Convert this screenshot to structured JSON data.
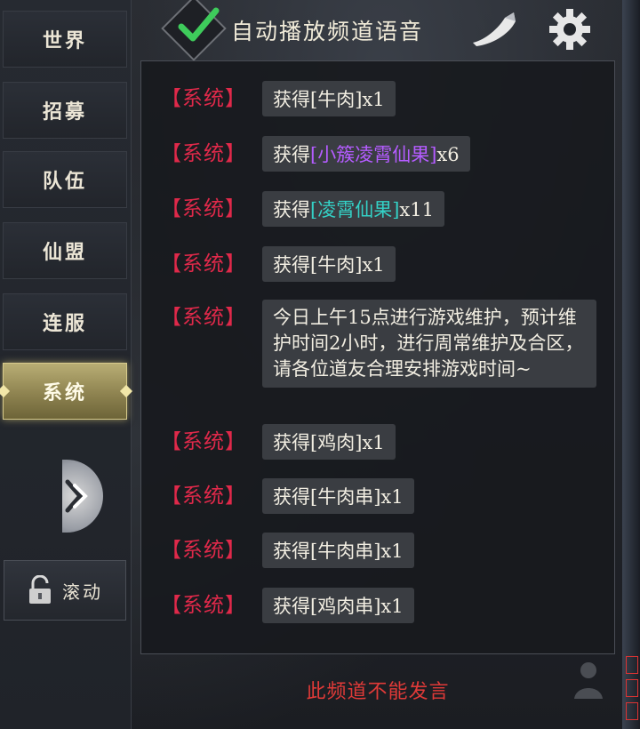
{
  "sidebar": {
    "tabs": [
      {
        "label": "世界"
      },
      {
        "label": "招募"
      },
      {
        "label": "队伍"
      },
      {
        "label": "仙盟"
      },
      {
        "label": "连服"
      },
      {
        "label": "系统"
      }
    ],
    "active_tab": "系统",
    "scroll_label": "滚动"
  },
  "header": {
    "title": "自动播放频道语音",
    "checked": true
  },
  "messages": [
    {
      "tag": "【系统】",
      "pre": "获得",
      "item": "[牛肉]",
      "item_color": "plain",
      "qty": "x1"
    },
    {
      "tag": "【系统】",
      "pre": "获得",
      "item": "[小簇凌霄仙果]",
      "item_color": "#b45cff",
      "qty": "x6"
    },
    {
      "tag": "【系统】",
      "pre": "获得",
      "item": "[凌霄仙果]",
      "item_color": "#34d1c6",
      "qty": "x11"
    },
    {
      "tag": "【系统】",
      "pre": "获得",
      "item": "[牛肉]",
      "item_color": "plain",
      "qty": "x1"
    },
    {
      "tag": "【系统】",
      "text": "今日上午15点进行游戏维护，预计维护时间2小时，进行周常维护及合区，请各位道友合理安排游戏时间~"
    },
    {
      "tag": "【系统】",
      "pre": "获得",
      "item": "[鸡肉]",
      "item_color": "plain",
      "qty": "x1"
    },
    {
      "tag": "【系统】",
      "pre": "获得",
      "item": "[牛肉串]",
      "item_color": "plain",
      "qty": "x1"
    },
    {
      "tag": "【系统】",
      "pre": "获得",
      "item": "[牛肉串]",
      "item_color": "plain",
      "qty": "x1"
    },
    {
      "tag": "【系统】",
      "pre": "获得",
      "item": "[鸡肉串]",
      "item_color": "plain",
      "qty": "x1"
    }
  ],
  "footer": {
    "notice": "此频道不能发言"
  },
  "colors": {
    "system_tag": "#e0294a",
    "active_tab": "#b8ad74",
    "notice": "#e03a38"
  },
  "icons": [
    "check-icon",
    "horn-icon",
    "gear-icon",
    "chevron-right-icon",
    "lock-icon",
    "person-icon"
  ]
}
